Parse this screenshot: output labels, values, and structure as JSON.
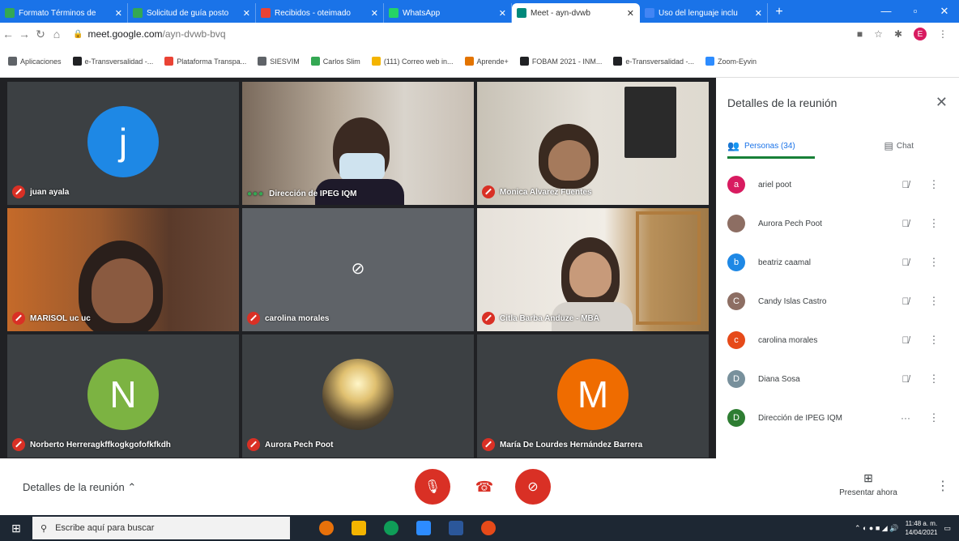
{
  "browser": {
    "tabs": [
      {
        "title": "Formato Términos de",
        "favicon_color": "#34a853",
        "active": false
      },
      {
        "title": "Solicitud de guía posto",
        "favicon_color": "#34a853",
        "active": false
      },
      {
        "title": "Recibidos - oteimado",
        "favicon_color": "#ea4335",
        "active": false
      },
      {
        "title": "WhatsApp",
        "favicon_color": "#25d366",
        "active": false
      },
      {
        "title": "Meet - ayn-dvwb",
        "favicon_color": "#00897b",
        "active": true
      },
      {
        "title": "Uso del lenguaje inclu",
        "favicon_color": "#4285f4",
        "active": false
      }
    ],
    "new_tab": "+",
    "window_controls": [
      "—",
      "▫",
      "✕"
    ],
    "url_host": "meet.google.com",
    "url_path": "/ayn-dvwb-bvq",
    "profile_initial": "E",
    "bookmarks": [
      {
        "label": "Aplicaciones",
        "color": "#5f6368"
      },
      {
        "label": "e-Transversalidad -...",
        "color": "#202124"
      },
      {
        "label": "Plataforma Transpa...",
        "color": "#ea4335"
      },
      {
        "label": "SIESVIM",
        "color": "#5f6368"
      },
      {
        "label": "Carlos Slim",
        "color": "#34a853"
      },
      {
        "label": "(111) Correo web in...",
        "color": "#f4b400"
      },
      {
        "label": "Aprende+",
        "color": "#e37400"
      },
      {
        "label": "FOBAM 2021 - INM...",
        "color": "#202124"
      },
      {
        "label": "e-Transversalidad -...",
        "color": "#202124"
      },
      {
        "label": "Zoom-Eyvin",
        "color": "#2d8cff"
      }
    ]
  },
  "meeting": {
    "tiles": [
      {
        "name": "juan ayala",
        "type": "avatar",
        "initial": "j",
        "color": "#1e88e5",
        "muted": true
      },
      {
        "name": "Dirección de IPEG IQM",
        "type": "video",
        "muted": false
      },
      {
        "name": "Monica Alvarez Fuentes",
        "type": "video",
        "muted": true
      },
      {
        "name": "MARISOL uc uc",
        "type": "video",
        "muted": true
      },
      {
        "name": "carolina morales",
        "type": "camoff",
        "muted": true
      },
      {
        "name": "Citla Barba Anduze - MBA",
        "type": "video",
        "muted": true
      },
      {
        "name": "Norberto Herreragkffkogkgofofkfkdh",
        "type": "avatar",
        "initial": "N",
        "color": "#7cb342",
        "muted": true
      },
      {
        "name": "Aurora Pech Poot",
        "type": "image",
        "muted": true
      },
      {
        "name": "María De Lourdes Hernández Barrera",
        "type": "avatar",
        "initial": "M",
        "color": "#ef6c00",
        "muted": true
      }
    ]
  },
  "panel": {
    "title": "Detalles de la reunión",
    "close": "✕",
    "tab_people": "Personas (34)",
    "tab_chat": "Chat",
    "people": [
      {
        "name": "ariel poot",
        "initial": "a",
        "color": "#d81b60",
        "status": "muted"
      },
      {
        "name": "Aurora Pech Poot",
        "initial": "",
        "color": "#8d6e63",
        "status": "muted"
      },
      {
        "name": "beatriz caamal",
        "initial": "b",
        "color": "#1e88e5",
        "status": "muted"
      },
      {
        "name": "Candy Islas Castro",
        "initial": "C",
        "color": "#8d6e63",
        "status": "muted"
      },
      {
        "name": "carolina morales",
        "initial": "c",
        "color": "#e64a19",
        "status": "muted"
      },
      {
        "name": "Diana Sosa",
        "initial": "D",
        "color": "#78909c",
        "status": "muted"
      },
      {
        "name": "Dirección de IPEG IQM",
        "initial": "D",
        "color": "#2e7d32",
        "status": "speaking"
      }
    ],
    "more_glyph": "⋮",
    "muted_glyph": "🎙̸",
    "speaking_glyph": "···"
  },
  "bottom": {
    "details_label": "Detalles de la reunión",
    "present_label": "Presentar ahora",
    "more_glyph": "⋮"
  },
  "taskbar": {
    "search_placeholder": "Escribe aquí para buscar",
    "time": "11:48 a. m.",
    "date": "14/04/2021"
  }
}
